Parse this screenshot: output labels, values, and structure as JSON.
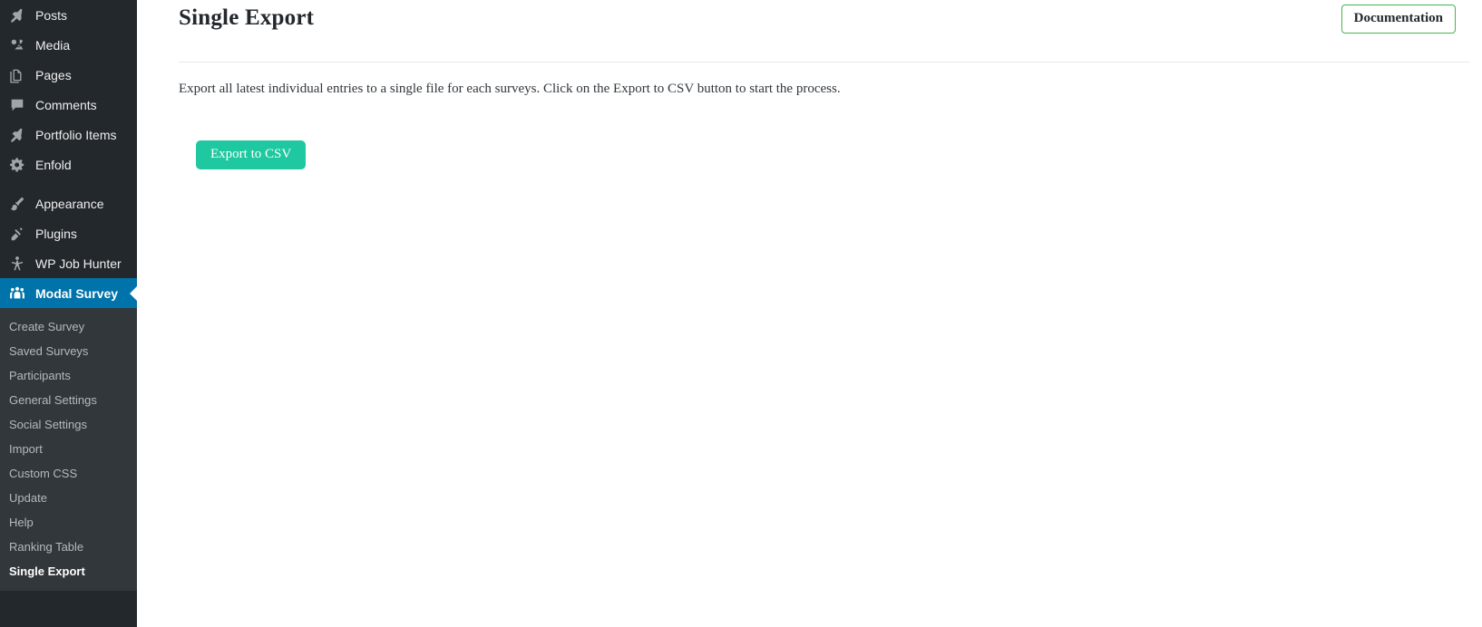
{
  "sidebar": {
    "menu": [
      {
        "label": "Posts",
        "icon": "pushpin-icon",
        "name": "sidebar-item-posts"
      },
      {
        "label": "Media",
        "icon": "camera-icon",
        "name": "sidebar-item-media"
      },
      {
        "label": "Pages",
        "icon": "pages-icon",
        "name": "sidebar-item-pages"
      },
      {
        "label": "Comments",
        "icon": "comment-icon",
        "name": "sidebar-item-comments"
      },
      {
        "label": "Portfolio Items",
        "icon": "pushpin-icon",
        "name": "sidebar-item-portfolio-items"
      },
      {
        "label": "Enfold",
        "icon": "gear-icon",
        "name": "sidebar-item-enfold"
      },
      {
        "label": "Appearance",
        "icon": "paintbrush-icon",
        "name": "sidebar-item-appearance"
      },
      {
        "label": "Plugins",
        "icon": "plug-icon",
        "name": "sidebar-item-plugins"
      },
      {
        "label": "WP Job Hunter",
        "icon": "person-icon",
        "name": "sidebar-item-wp-job-hunter"
      },
      {
        "label": "Modal Survey",
        "icon": "groups-icon",
        "name": "sidebar-item-modal-survey"
      }
    ],
    "submenu": [
      {
        "label": "Create Survey",
        "name": "submenu-item-create-survey"
      },
      {
        "label": "Saved Surveys",
        "name": "submenu-item-saved-surveys"
      },
      {
        "label": "Participants",
        "name": "submenu-item-participants"
      },
      {
        "label": "General Settings",
        "name": "submenu-item-general-settings"
      },
      {
        "label": "Social Settings",
        "name": "submenu-item-social-settings"
      },
      {
        "label": "Import",
        "name": "submenu-item-import"
      },
      {
        "label": "Custom CSS",
        "name": "submenu-item-custom-css"
      },
      {
        "label": "Update",
        "name": "submenu-item-update"
      },
      {
        "label": "Help",
        "name": "submenu-item-help"
      },
      {
        "label": "Ranking Table",
        "name": "submenu-item-ranking-table"
      },
      {
        "label": "Single Export",
        "name": "submenu-item-single-export"
      }
    ],
    "active_menu_index": 9,
    "current_submenu_index": 10,
    "colors": {
      "background": "#23282d",
      "submenu_background": "#32373c",
      "active": "#0073aa",
      "text": "#eeeeee",
      "submenu_text": "#b4b9be"
    }
  },
  "header": {
    "title": "Single Export",
    "documentation_label": "Documentation"
  },
  "main": {
    "description": "Export all latest individual entries to a single file for each surveys. Click on the Export to CSV button to start the process.",
    "export_label": "Export to CSV"
  },
  "colors": {
    "export_button": "#1fc8a0",
    "documentation_border": "#46b450",
    "divider": "#e8e8e8",
    "title_text": "#23282d"
  }
}
